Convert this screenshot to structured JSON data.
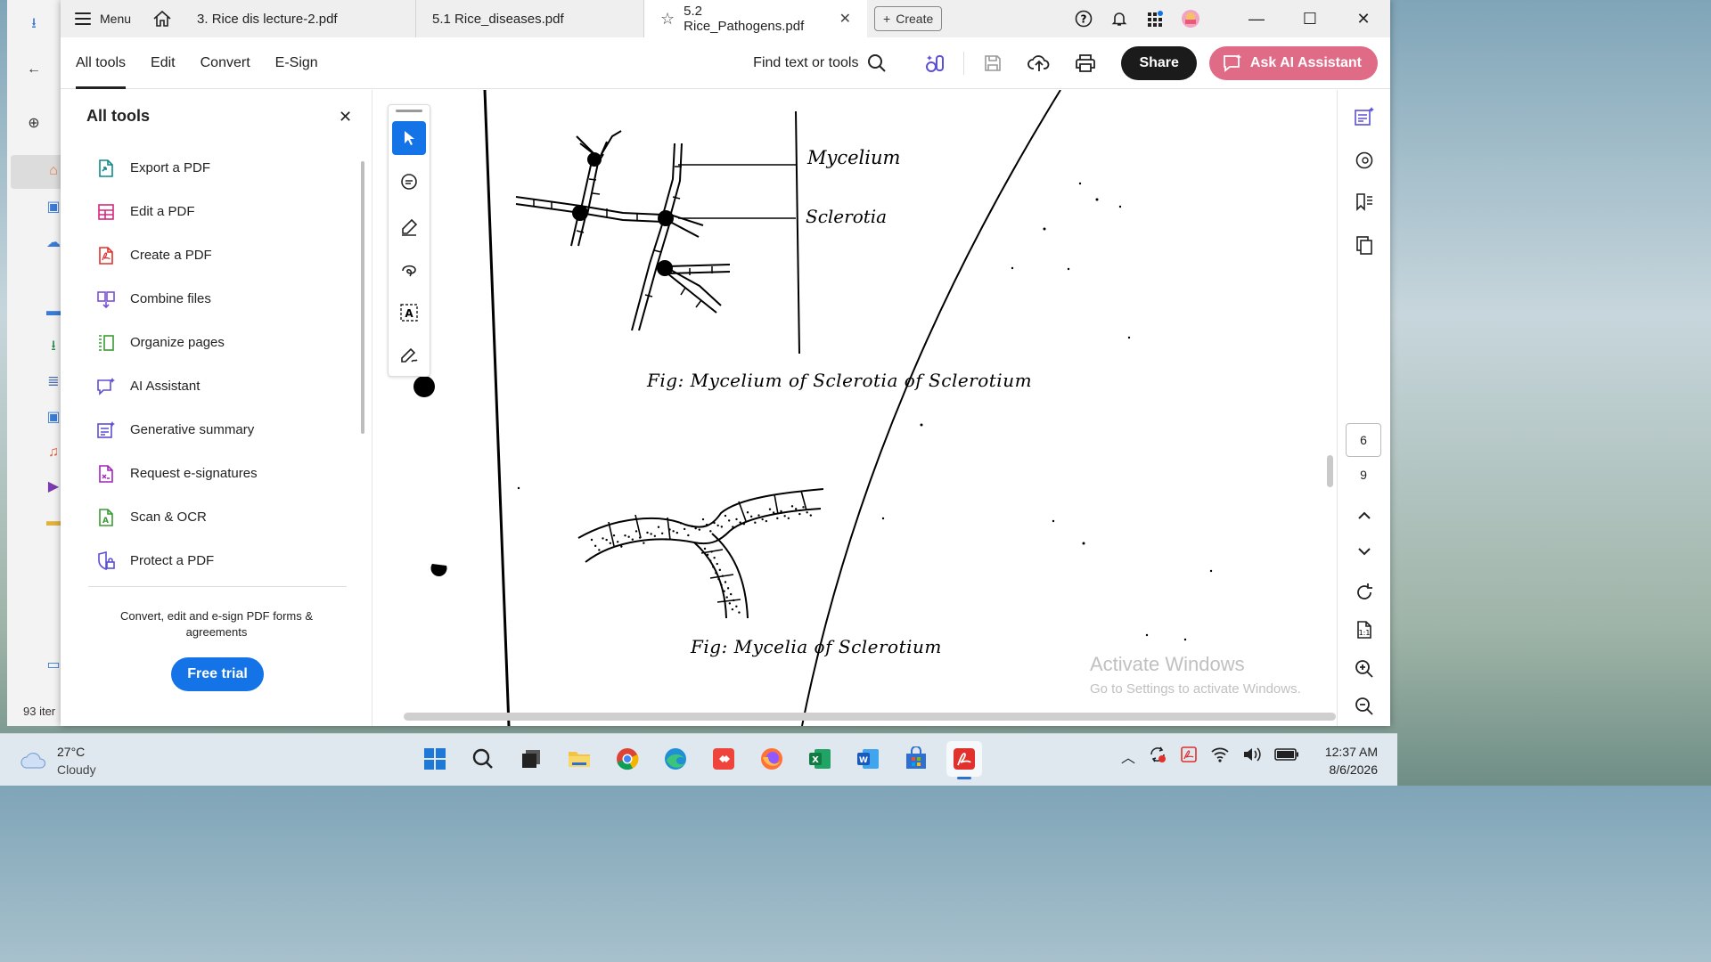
{
  "window": {
    "menu_label": "Menu",
    "tabs": [
      {
        "label": "3. Rice dis lecture-2.pdf"
      },
      {
        "label": "5.1 Rice_diseases.pdf"
      },
      {
        "label": "5.2 Rice_Pathogens.pdf"
      }
    ],
    "create_label": "Create"
  },
  "toolbar": {
    "menu": [
      "All tools",
      "Edit",
      "Convert",
      "E-Sign"
    ],
    "find_label": "Find text or tools",
    "share_label": "Share",
    "ai_label": "Ask AI Assistant"
  },
  "panel": {
    "title": "All tools",
    "items": [
      {
        "label": "Export a PDF",
        "icon": "export-pdf-icon",
        "color": "#0f8a8a"
      },
      {
        "label": "Edit a PDF",
        "icon": "edit-pdf-icon",
        "color": "#d6287b"
      },
      {
        "label": "Create a PDF",
        "icon": "create-pdf-icon",
        "color": "#e0312c"
      },
      {
        "label": "Combine files",
        "icon": "combine-files-icon",
        "color": "#7a4fd6"
      },
      {
        "label": "Organize pages",
        "icon": "organize-pages-icon",
        "color": "#3a9a34"
      },
      {
        "label": "AI Assistant",
        "icon": "ai-assistant-icon",
        "color": "#5b4fd6"
      },
      {
        "label": "Generative summary",
        "icon": "generative-summary-icon",
        "color": "#5b4fd6"
      },
      {
        "label": "Request e-signatures",
        "icon": "request-esign-icon",
        "color": "#a026b8"
      },
      {
        "label": "Scan & OCR",
        "icon": "scan-ocr-icon",
        "color": "#3a9a34"
      },
      {
        "label": "Protect a PDF",
        "icon": "protect-pdf-icon",
        "color": "#5b4fd6"
      }
    ],
    "promo_text": "Convert, edit and e-sign PDF forms & agreements",
    "free_trial_label": "Free trial"
  },
  "document": {
    "label_mycelium": "Mycelium",
    "label_sclerotia": "Sclerotia",
    "caption1": "Fig: Mycelium of Sclerotia of Sclerotium",
    "caption2": "Fig: Mycelia of Sclerotium"
  },
  "watermark": {
    "line1": "Activate Windows",
    "line2": "Go to Settings to activate Windows."
  },
  "rail": {
    "current_page": "6",
    "total_pages": "9"
  },
  "explorer": {
    "item_count": "93 iter"
  },
  "taskbar": {
    "temp": "27°C",
    "condition": "Cloudy",
    "time": "12:37 AM",
    "date": "8/6/2026"
  }
}
